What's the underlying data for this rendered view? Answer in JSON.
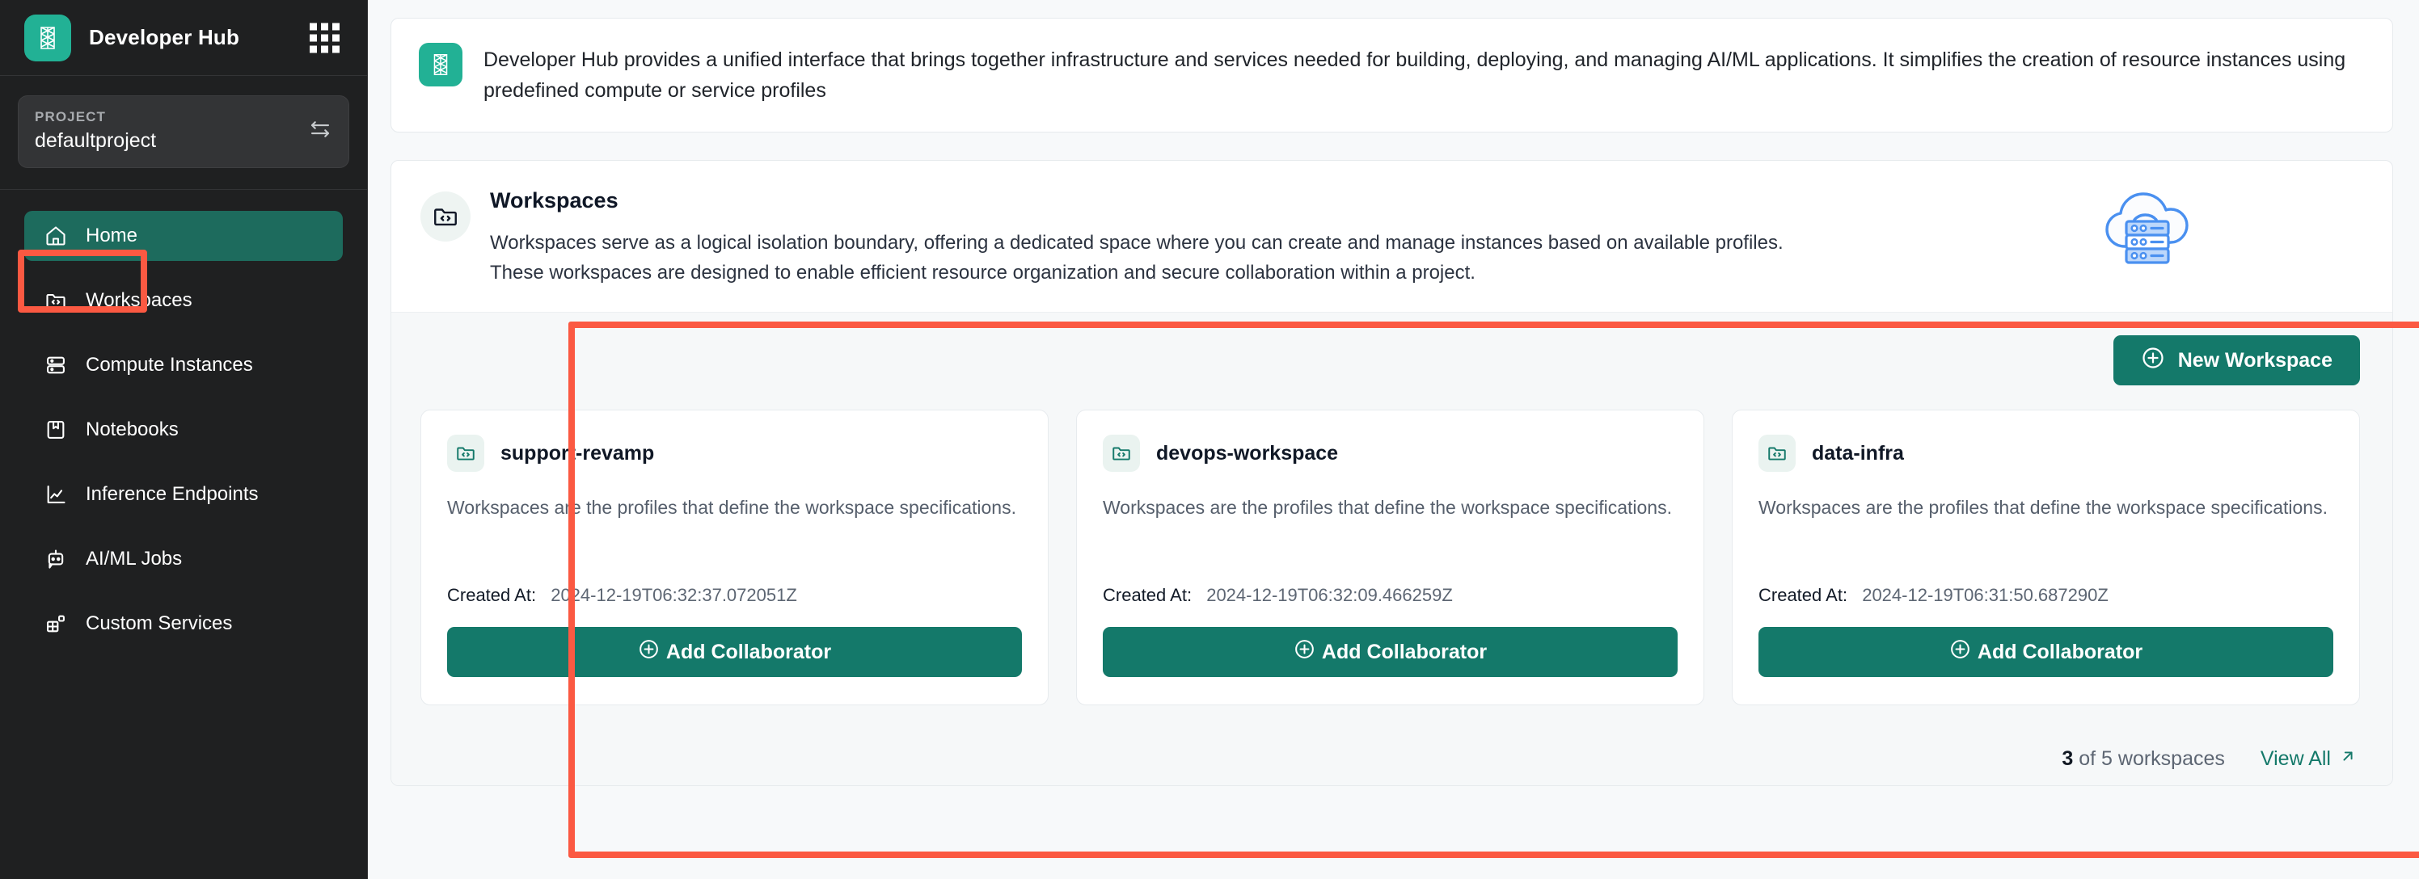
{
  "brand": {
    "title": "Developer Hub",
    "logo_icon": "developer-hub-logo",
    "apps_icon": "apps-grid-icon"
  },
  "project": {
    "label": "PROJECT",
    "value": "defaultproject",
    "switch_icon": "swap-arrows-icon"
  },
  "sidebar": {
    "items": [
      {
        "label": "Home",
        "icon": "home-icon",
        "active": true
      },
      {
        "label": "Workspaces",
        "icon": "folder-code-icon",
        "active": false
      },
      {
        "label": "Compute Instances",
        "icon": "server-icon",
        "active": false
      },
      {
        "label": "Notebooks",
        "icon": "notebook-icon",
        "active": false
      },
      {
        "label": "Inference Endpoints",
        "icon": "chart-line-icon",
        "active": false
      },
      {
        "label": "AI/ML Jobs",
        "icon": "robot-icon",
        "active": false
      },
      {
        "label": "Custom Services",
        "icon": "blocks-icon",
        "active": false
      }
    ]
  },
  "intro": {
    "text": "Developer Hub provides a unified interface that brings together infrastructure and services needed for building, deploying, and managing AI/ML applications. It simplifies the creation of resource instances using predefined compute or service profiles",
    "logo_icon": "developer-hub-logo"
  },
  "workspaces_section": {
    "icon": "folder-code-icon",
    "title": "Workspaces",
    "description_line1": "Workspaces serve as a logical isolation boundary, offering a dedicated space where you can create and manage instances based on available profiles.",
    "description_line2": "These workspaces are designed to enable efficient resource organization and secure collaboration within a project.",
    "illustration_icon": "cloud-server-wifi-illustration",
    "new_workspace_button": "New Workspace",
    "new_workspace_icon": "plus-circle-icon",
    "created_at_label": "Created At:",
    "add_collaborator_label": "Add Collaborator",
    "add_collaborator_icon": "plus-circle-icon",
    "count_prefix": "3",
    "count_suffix": " of 5 workspaces",
    "view_all_label": "View All",
    "view_all_icon": "arrow-up-right-icon",
    "cards": [
      {
        "name": "support-revamp",
        "description": "Workspaces are the profiles that define the workspace specifications.",
        "created_at": "2024-12-19T06:32:37.072051Z"
      },
      {
        "name": "devops-workspace",
        "description": "Workspaces are the profiles that define the workspace specifications.",
        "created_at": "2024-12-19T06:32:09.466259Z"
      },
      {
        "name": "data-infra",
        "description": "Workspaces are the profiles that define the workspace specifications.",
        "created_at": "2024-12-19T06:31:50.687290Z"
      }
    ]
  },
  "colors": {
    "brand_teal": "#22b195",
    "accent_green": "#14796a",
    "active_nav": "#1d6b5d",
    "annotation_red": "#fb5942",
    "sidebar_bg": "#1f2021",
    "illustration_blue": "#4a90f0"
  }
}
